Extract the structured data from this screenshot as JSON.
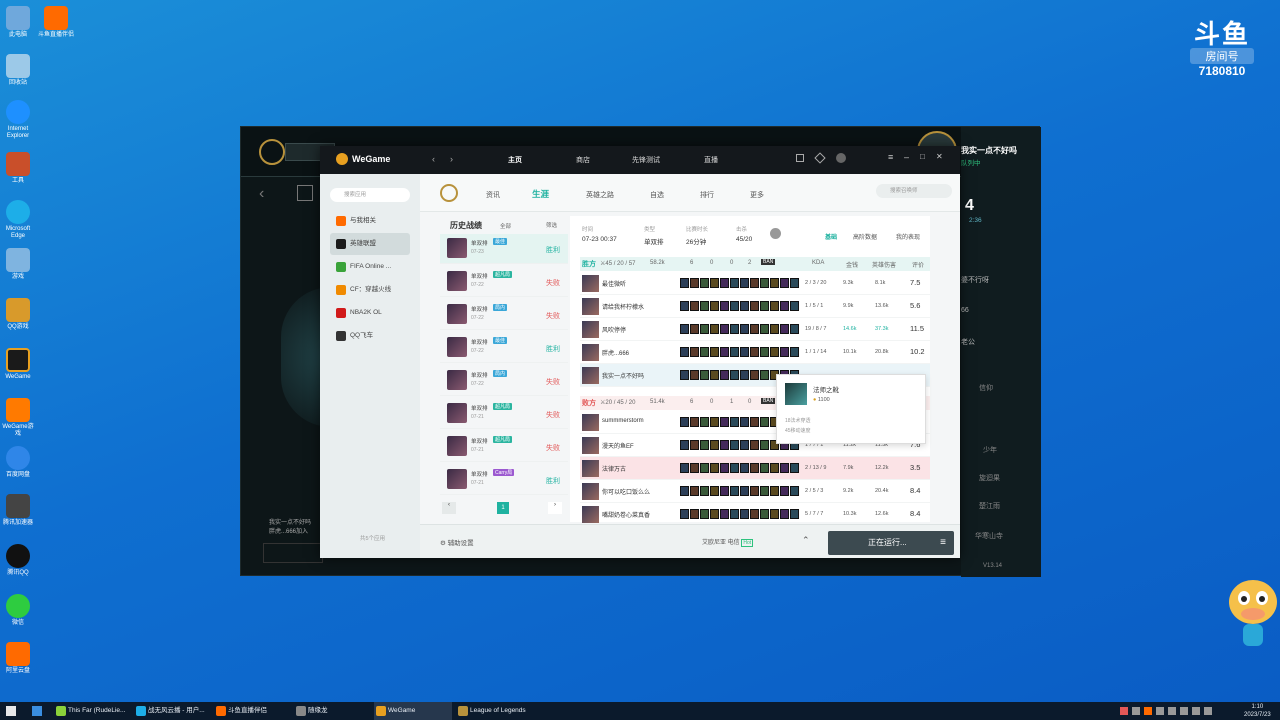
{
  "desktop": {
    "icons": [
      {
        "label": "此电脑",
        "color": "#6fa8dc"
      },
      {
        "label": "斗鱼直播伴侣",
        "color": "#ff6a00"
      },
      {
        "label": "回收站",
        "color": "#9cc9e8"
      },
      {
        "label": "Internet Explorer",
        "color": "#1e90ff"
      },
      {
        "label": "工具",
        "color": "#c94f2a"
      },
      {
        "label": "Microsoft Edge",
        "color": "#1daee8"
      },
      {
        "label": "游戏",
        "color": "#7fb4e0"
      },
      {
        "label": "QQ游戏",
        "color": "#d89a2b"
      },
      {
        "label": "WeGame",
        "color": "#e8a020"
      },
      {
        "label": "WeGame游戏",
        "color": "#ff7a00"
      },
      {
        "label": "百度网盘",
        "color": "#2f86e8"
      },
      {
        "label": "腾讯加速器",
        "color": "#444444"
      },
      {
        "label": "腾讯QQ",
        "color": "#111111"
      },
      {
        "label": "微信",
        "color": "#2ecc40"
      },
      {
        "label": "阿里云盘",
        "color": "#ff6a00"
      }
    ]
  },
  "douyu": {
    "logo": "斗鱼",
    "room_label": "房间号",
    "room_number": "7180810"
  },
  "lol": {
    "chat_name": "我实一点不好吗",
    "chat_sub": "队列中",
    "timer_big": "4",
    "timer_small": "2:36",
    "side_texts": [
      "婆不行呀",
      "66",
      "老公",
      "信仰",
      "少年",
      "旋迴果",
      "楚江雨",
      "华寒山寺"
    ],
    "chat_lines": [
      "我实一点不好吗",
      "胖虎...666加入"
    ],
    "version": "V13.14"
  },
  "wegame": {
    "title": "WeGame",
    "nav_tabs": [
      "主页",
      "商店",
      "先锋测试",
      "直播"
    ],
    "sidebar": {
      "search_placeholder": "搜索应用",
      "items": [
        {
          "label": "与我相关",
          "color": "#ff6a00"
        },
        {
          "label": "英雄联盟",
          "color": "#1b1b1b"
        },
        {
          "label": "FIFA Online ...",
          "color": "#3aa33a"
        },
        {
          "label": "CF：穿越火线",
          "color": "#f08a00"
        },
        {
          "label": "NBA2K OL",
          "color": "#d11a1a"
        },
        {
          "label": "QQ飞车",
          "color": "#333333"
        }
      ],
      "footer": "共5个应用"
    },
    "game_nav": [
      "资讯",
      "生涯",
      "英雄之路",
      "自选",
      "排行",
      "更多"
    ],
    "game_search": "搜索召唤师",
    "history": {
      "title": "历史战绩",
      "filter_mode": "全部",
      "filter": "筛选",
      "rows": [
        {
          "mode": "单双排",
          "tag": "最佳",
          "date": "07-23",
          "result": "胜利",
          "win": true
        },
        {
          "mode": "单双排",
          "tag": "超凡局",
          "date": "07-22",
          "result": "失败",
          "win": false
        },
        {
          "mode": "单双排",
          "tag": "局内",
          "date": "07-22",
          "result": "失败",
          "win": false
        },
        {
          "mode": "单双排",
          "tag": "最佳",
          "date": "07-22",
          "result": "胜利",
          "win": true
        },
        {
          "mode": "单双排",
          "tag": "局内",
          "date": "07-22",
          "result": "失败",
          "win": false
        },
        {
          "mode": "单双排",
          "tag": "超凡局",
          "date": "07-21",
          "result": "失败",
          "win": false
        },
        {
          "mode": "单双排",
          "tag": "超凡局",
          "date": "07-21",
          "result": "失败",
          "win": false
        },
        {
          "mode": "单双排",
          "tag": "Carry局",
          "date": "07-21",
          "result": "胜利",
          "win": true
        }
      ],
      "page": "1"
    },
    "match": {
      "time_label": "时间",
      "time_value": "07-23 00:37",
      "type_label": "类型",
      "type_value": "单双排",
      "duration_label": "比赛时长",
      "duration_value": "26分钟",
      "kills_label": "击杀",
      "kills_value": "45/20",
      "tabs": [
        "基础",
        "高阶数据",
        "我的表现"
      ],
      "win_team": {
        "label": "胜方",
        "stats": "⚔45 / 20 / 57",
        "gold": "58.2k",
        "towers": "6",
        "dragons": "0",
        "barons": "0",
        "heralds": "2",
        "ban": "BAN",
        "cols": [
          "KDA",
          "金钱",
          "英雄伤害",
          "评价"
        ],
        "players": [
          {
            "name": "最佳微听",
            "kda": "2 / 3 / 20",
            "gold": "9.3k",
            "dmg": "8.1k",
            "score": "7.5"
          },
          {
            "name": "请给我杯柠檬水",
            "kda": "1 / 5 / 1",
            "gold": "9.9k",
            "dmg": "13.6k",
            "score": "5.6"
          },
          {
            "name": "风吹停停",
            "kda": "19 / 8 / 7",
            "gold": "14.6k",
            "dmg": "37.3k",
            "score": "11.5"
          },
          {
            "name": "胖虎...666",
            "kda": "1 / 1 / 14",
            "gold": "10.1k",
            "dmg": "20.8k",
            "score": "10.2"
          },
          {
            "name": "我实一点不好吗",
            "kda": "",
            "gold": "",
            "dmg": "",
            "score": ""
          }
        ]
      },
      "lose_team": {
        "label": "败方",
        "stats": "⚔20 / 45 / 20",
        "gold": "51.4k",
        "towers": "6",
        "dragons": "0",
        "barons": "1",
        "heralds": "0",
        "ban": "BAN",
        "players": [
          {
            "name": "summmerstorm",
            "kda": "",
            "gold": "",
            "dmg": "",
            "score": "7.6"
          },
          {
            "name": "漫天的鱼EF",
            "kda": "1 / 7 / 1",
            "gold": "11.2k",
            "dmg": "11.5k",
            "score": "7.6"
          },
          {
            "name": "法律万古",
            "kda": "2 / 13 / 9",
            "gold": "7.9k",
            "dmg": "12.2k",
            "score": "3.5"
          },
          {
            "name": "你可以吃口饭么么",
            "kda": "2 / 5 / 3",
            "gold": "9.2k",
            "dmg": "20.4k",
            "score": "8.4"
          },
          {
            "name": "嘴甜奶卷心菜真香",
            "kda": "5 / 7 / 7",
            "gold": "10.3k",
            "dmg": "12.6k",
            "score": "8.4"
          }
        ]
      }
    },
    "tooltip": {
      "title": "法师之靴",
      "cost": "1100",
      "line1": "18法术穿透",
      "line2": "45移动速度"
    },
    "bottom": {
      "helper": "辅助设置",
      "server": "艾欧尼亚 电信",
      "server_badge": "Hot",
      "running": "正在运行..."
    }
  },
  "taskbar": {
    "items": [
      "This Far (RudeLie...",
      "战无风云播 - 用户...",
      "斗鱼直播伴侣",
      "随缘龙",
      "WeGame",
      "League of Legends"
    ],
    "time": "1:10",
    "date": "2023/7/23"
  }
}
